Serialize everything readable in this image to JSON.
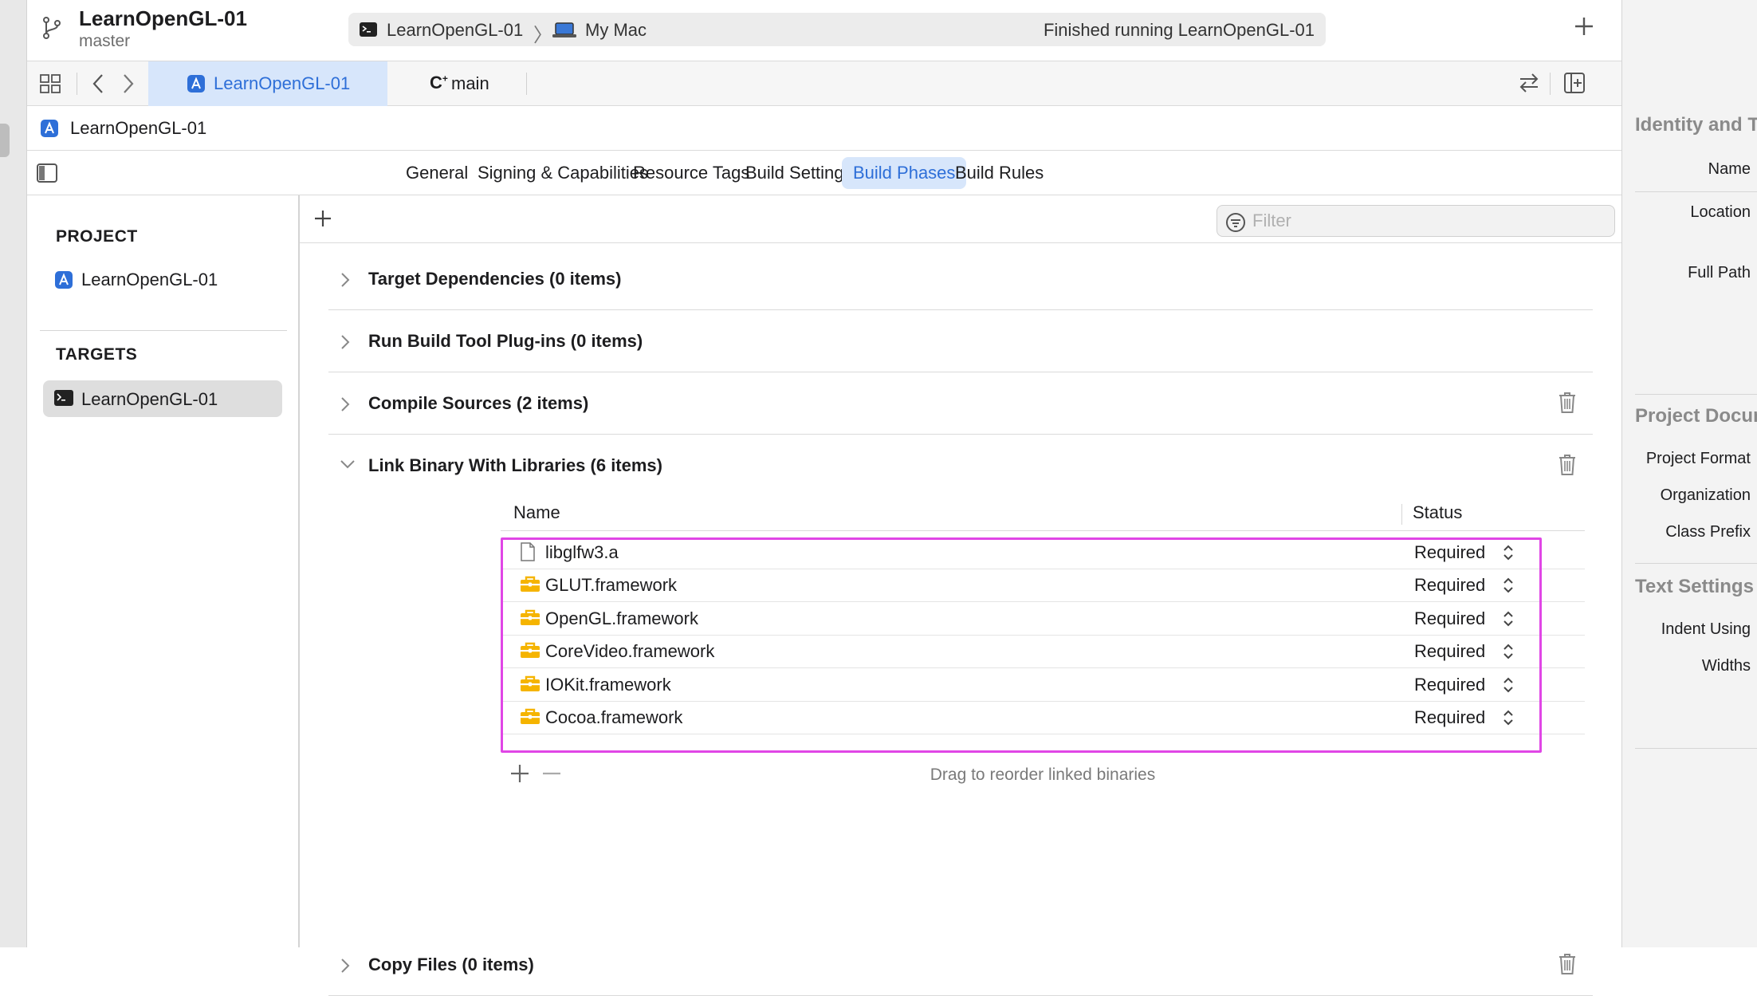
{
  "toolbar": {
    "project_name": "LearnOpenGL-01",
    "branch": "master",
    "scheme": "LearnOpenGL-01",
    "destination": "My Mac",
    "status": "Finished running LearnOpenGL-01"
  },
  "tabs": {
    "active_label": "LearnOpenGL-01",
    "main_prefix": "C",
    "main_label": "main"
  },
  "jumpbar": {
    "label": "LearnOpenGL-01"
  },
  "editor_tabs": [
    "General",
    "Signing & Capabilities",
    "Resource Tags",
    "Build Settings",
    "Build Phases",
    "Build Rules"
  ],
  "sidebar": {
    "project_header": "PROJECT",
    "project_item": "LearnOpenGL-01",
    "targets_header": "TARGETS",
    "target_item": "LearnOpenGL-01"
  },
  "filter": {
    "placeholder": "Filter"
  },
  "phases": {
    "target_dependencies": "Target Dependencies (0 items)",
    "run_build_tool_plugins": "Run Build Tool Plug-ins (0 items)",
    "compile_sources": "Compile Sources (2 items)",
    "link_binary": "Link Binary With Libraries (6 items)",
    "copy_files": "Copy Files (0 items)"
  },
  "libraries": {
    "col_name": "Name",
    "col_status": "Status",
    "rows": [
      {
        "name": "libglfw3.a",
        "status": "Required",
        "icon": "file-icon"
      },
      {
        "name": "GLUT.framework",
        "status": "Required",
        "icon": "toolbox-icon"
      },
      {
        "name": "OpenGL.framework",
        "status": "Required",
        "icon": "toolbox-icon"
      },
      {
        "name": "CoreVideo.framework",
        "status": "Required",
        "icon": "toolbox-icon"
      },
      {
        "name": "IOKit.framework",
        "status": "Required",
        "icon": "toolbox-icon"
      },
      {
        "name": "Cocoa.framework",
        "status": "Required",
        "icon": "toolbox-icon"
      }
    ],
    "footer_hint": "Drag to reorder linked binaries"
  },
  "inspector": {
    "identity_header": "Identity and Type",
    "name_label": "Name",
    "location_label": "Location",
    "full_path_label": "Full Path",
    "project_doc_header": "Project Document",
    "project_format_label": "Project Format",
    "organization_label": "Organization",
    "class_prefix_label": "Class Prefix",
    "text_settings_header": "Text Settings",
    "indent_using_label": "Indent Using",
    "widths_label": "Widths"
  },
  "colors": {
    "accent": "#2e6fd8",
    "selection_blue": "#d7e6fb",
    "highlight_magenta": "#e046e6",
    "framework_yellow": "#f5b400"
  }
}
